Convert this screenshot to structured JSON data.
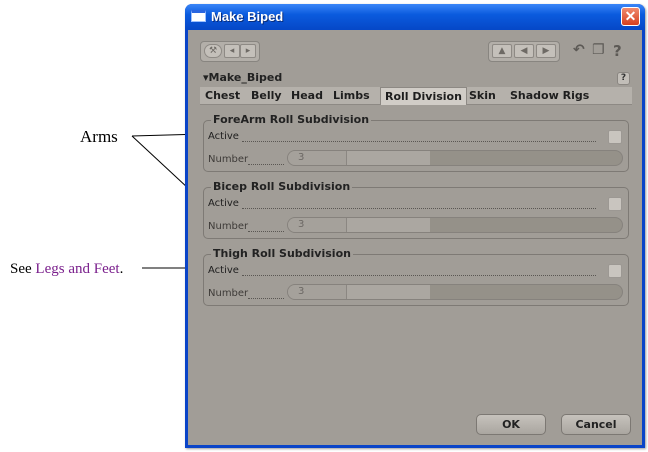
{
  "annotations": {
    "arms": "Arms",
    "see_prefix": "See ",
    "see_link": "Legs and Feet",
    "see_suffix": "."
  },
  "window": {
    "title": "Make Biped",
    "close_glyph": "✕",
    "title_bar_color": "#0b5bde",
    "client_color": "#a19d97"
  },
  "toolbar": {
    "icons": [
      "wrench-icon",
      "left-arrow-icon",
      "right-arrow-icon",
      "triangle-nav-icon",
      "undo-icon",
      "copy-icon",
      "help-icon"
    ],
    "help_glyph": "?"
  },
  "panel": {
    "title": "▾Make_Biped",
    "help_glyph": "?",
    "tabs": [
      "Chest",
      "Belly",
      "Head",
      "Limbs",
      "Roll Division",
      "Skin",
      "Shadow Rigs"
    ],
    "active_tab": "Roll Division"
  },
  "groups": [
    {
      "legend": "ForeArm Roll Subdivision",
      "active_label": "Active",
      "number_label": "Number",
      "value": "3",
      "checked": false
    },
    {
      "legend": "Bicep  Roll Subdivision",
      "active_label": "Active",
      "number_label": "Number",
      "value": "3",
      "checked": false
    },
    {
      "legend": "Thigh  Roll Subdivision",
      "active_label": "Active",
      "number_label": "Number",
      "value": "3",
      "checked": false
    }
  ],
  "buttons": {
    "ok": "OK",
    "cancel": "Cancel"
  }
}
